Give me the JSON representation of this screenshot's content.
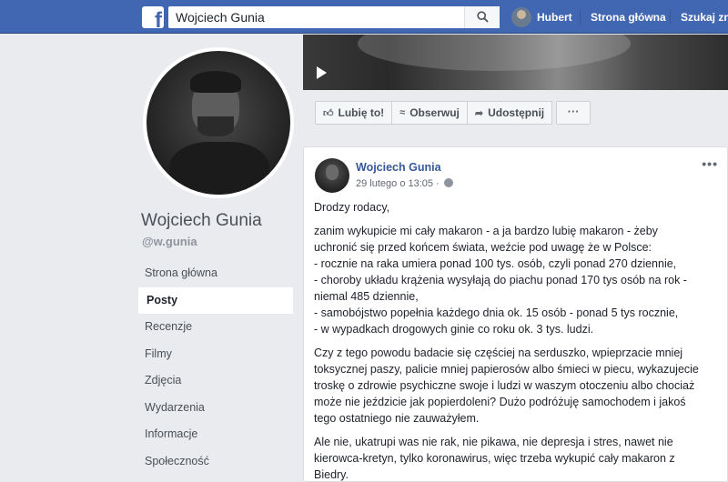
{
  "topbar": {
    "logo": "f",
    "search_value": "Wojciech Gunia",
    "search_icon": "search-icon",
    "user_name": "Hubert",
    "nav_home": "Strona główna",
    "nav_find": "Szukaj zn"
  },
  "sidebar": {
    "page_name": "Wojciech Gunia",
    "handle": "@w.gunia",
    "items": [
      {
        "label": "Strona główna"
      },
      {
        "label": "Posty"
      },
      {
        "label": "Recenzje"
      },
      {
        "label": "Filmy"
      },
      {
        "label": "Zdjęcia"
      },
      {
        "label": "Wydarzenia"
      },
      {
        "label": "Informacje"
      },
      {
        "label": "Społeczność"
      }
    ],
    "active_index": 1
  },
  "actions": {
    "like": "Lubię to!",
    "follow": "Obserwuj",
    "share": "Udostępnij",
    "more": "···"
  },
  "post": {
    "author": "Wojciech Gunia",
    "date": "29 lutego o 13:05 ·",
    "menu": "•••",
    "greeting": "Drodzy rodacy,",
    "para1": [
      "zanim wykupicie mi cały makaron - a ja bardzo lubię makaron - żeby",
      "uchronić się przed końcem świata, weźcie pod uwagę że w Polsce:",
      "- rocznie na raka umiera ponad 100 tys. osób, czyli ponad 270 dziennie,",
      "- choroby układu krążenia wysyłają do piachu ponad 170 tys osób na rok -",
      "niemal 485 dziennie,",
      "- samobójstwo popełnia każdego dnia ok. 15 osób - ponad 5 tys rocznie,",
      "- w wypadkach drogowych ginie co roku ok. 3 tys. ludzi."
    ],
    "para2": [
      "Czy z tego powodu badacie się częściej na serduszko, wpieprzacie mniej",
      "toksycznej paszy, palicie mniej papierosów albo śmieci w piecu, wykazujecie",
      "troskę o zdrowie psychiczne swoje i ludzi w waszym otoczeniu albo chociaż",
      "może nie jeździcie jak popierdoleni? Dużo podróżuję samochodem i jakoś",
      "tego ostatniego nie zauważyłem."
    ],
    "para3": [
      "Ale nie, ukatrupi was nie rak, nie pikawa, nie depresja i stres, nawet nie",
      "kierowca-kretyn, tylko koronawirus, więc trzeba wykupić cały makaron z",
      "Biedry."
    ]
  }
}
